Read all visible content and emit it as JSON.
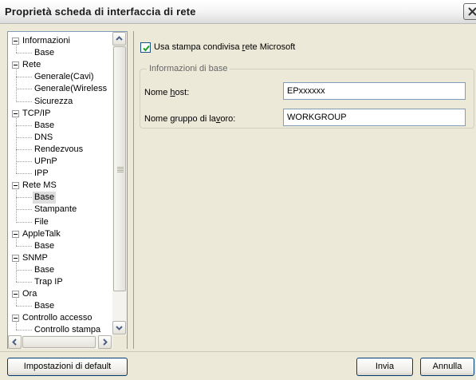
{
  "window": {
    "title": "Proprietà scheda di interfaccia di rete"
  },
  "tree": {
    "items": [
      {
        "label": "Informazioni",
        "type": "parent"
      },
      {
        "label": "Base",
        "type": "child"
      },
      {
        "label": "Rete",
        "type": "parent"
      },
      {
        "label": "Generale(Cavi)",
        "type": "child"
      },
      {
        "label": "Generale(Wireless",
        "type": "child"
      },
      {
        "label": "Sicurezza",
        "type": "child"
      },
      {
        "label": "TCP/IP",
        "type": "parent"
      },
      {
        "label": "Base",
        "type": "child"
      },
      {
        "label": "DNS",
        "type": "child"
      },
      {
        "label": "Rendezvous",
        "type": "child"
      },
      {
        "label": "UPnP",
        "type": "child"
      },
      {
        "label": "IPP",
        "type": "child"
      },
      {
        "label": "Rete MS",
        "type": "parent"
      },
      {
        "label": "Base",
        "type": "child",
        "selected": true
      },
      {
        "label": "Stampante",
        "type": "child"
      },
      {
        "label": "File",
        "type": "child"
      },
      {
        "label": "AppleTalk",
        "type": "parent"
      },
      {
        "label": "Base",
        "type": "child"
      },
      {
        "label": "SNMP",
        "type": "parent"
      },
      {
        "label": "Base",
        "type": "child"
      },
      {
        "label": "Trap IP",
        "type": "child"
      },
      {
        "label": "Ora",
        "type": "parent"
      },
      {
        "label": "Base",
        "type": "child"
      },
      {
        "label": "Controllo accesso",
        "type": "parent"
      },
      {
        "label": "Controllo stampa",
        "type": "child"
      }
    ]
  },
  "share_option": {
    "label_before": "Usa stampa condivisa ",
    "label_accel": "r",
    "label_after": "ete Microsoft",
    "checked": true
  },
  "basic_info": {
    "legend": "Informazioni di base",
    "host_label_before": "Nome ",
    "host_label_accel": "h",
    "host_label_after": "ost:",
    "host_value": "EPxxxxxx",
    "workgroup_label_before": "Nome ",
    "workgroup_label_accel": "g",
    "workgroup_label_middle": "ruppo di la",
    "workgroup_label_accel2": "v",
    "workgroup_label_after": "oro:",
    "workgroup_value": "WORKGROUP"
  },
  "buttons": {
    "defaults": "Impostazioni di default",
    "send": "Invia",
    "cancel": "Annulla"
  }
}
